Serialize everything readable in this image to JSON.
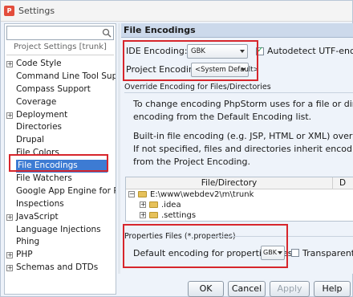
{
  "window": {
    "title": "Settings"
  },
  "left": {
    "search": {
      "value": "",
      "placeholder": ""
    },
    "header": "Project Settings [trunk]",
    "items": [
      {
        "label": "Code Style",
        "expandable": true
      },
      {
        "label": "Command Line Tool Supp...",
        "expandable": false
      },
      {
        "label": "Compass Support",
        "expandable": false
      },
      {
        "label": "Coverage",
        "expandable": false
      },
      {
        "label": "Deployment",
        "expandable": true
      },
      {
        "label": "Directories",
        "expandable": false
      },
      {
        "label": "Drupal",
        "expandable": false
      },
      {
        "label": "File Colors",
        "expandable": false
      },
      {
        "label": "File Encodings",
        "expandable": false,
        "selected": true
      },
      {
        "label": "File Watchers",
        "expandable": false
      },
      {
        "label": "Google App Engine for PHP",
        "expandable": false
      },
      {
        "label": "Inspections",
        "expandable": false
      },
      {
        "label": "JavaScript",
        "expandable": true
      },
      {
        "label": "Language Injections",
        "expandable": false
      },
      {
        "label": "Phing",
        "expandable": false
      },
      {
        "label": "PHP",
        "expandable": true
      },
      {
        "label": "Schemas and DTDs",
        "expandable": true
      }
    ]
  },
  "right": {
    "title": "File Encodings",
    "ide_encoding": {
      "label": "IDE Encoding:",
      "value": "GBK"
    },
    "autodetect": {
      "label": "Autodetect UTF-encoded f",
      "checked": true
    },
    "project_encoding": {
      "label": "Project Encoding:",
      "value": "<System Default>"
    },
    "override_title": "Override Encoding for Files/Directories",
    "para1": [
      "To change encoding PhpStorm uses for a file or directory, click an",
      "encoding from the Default Encoding list."
    ],
    "para2": [
      "Built-in file encoding (e.g. JSP, HTML or XML) overrides encoding y",
      "If not specified, files and directories inherit encoding settings from",
      "from the Project Encoding."
    ],
    "table": {
      "col_file": "File/Directory",
      "col_d": "D",
      "rows": [
        {
          "label": "E:\\www\\webdev2\\m\\trunk",
          "level": 0,
          "expandable": true
        },
        {
          "label": ".idea",
          "level": 1,
          "expandable": true
        },
        {
          "label": ".settings",
          "level": 1,
          "expandable": true
        }
      ]
    },
    "properties_title": "Properties Files (*.properties)",
    "properties_encoding": {
      "label": "Default encoding for properties files:",
      "value": "GBK"
    },
    "transparent": {
      "label": "Transparent na",
      "checked": false
    }
  },
  "buttons": {
    "ok": "OK",
    "cancel": "Cancel",
    "apply": "Apply",
    "help": "Help"
  },
  "colors": {
    "selection": "#3d7bd3",
    "highlight": "#d7262c",
    "header_bg": "#ccd9eb"
  }
}
